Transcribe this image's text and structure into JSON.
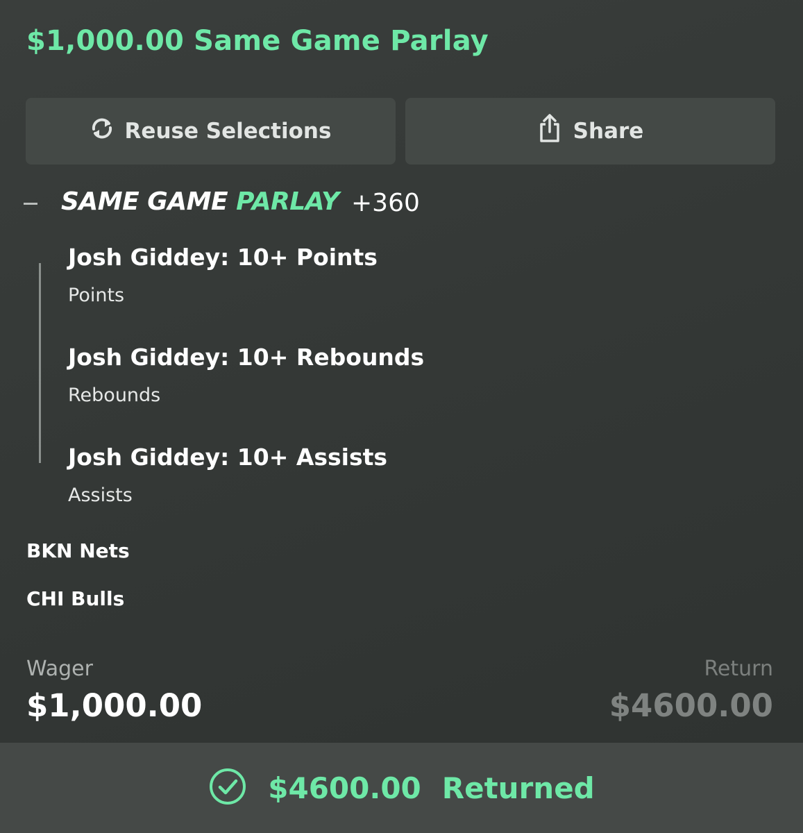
{
  "header": {
    "title": "$1,000.00 Same Game Parlay"
  },
  "actions": {
    "reuse_label": "Reuse Selections",
    "share_label": "Share"
  },
  "parlay": {
    "label_part1": "SAME GAME ",
    "label_part2": "PARLAY",
    "odds": "+360",
    "legs": [
      {
        "title": "Josh Giddey: 10+ Points",
        "market": "Points"
      },
      {
        "title": "Josh Giddey: 10+ Rebounds",
        "market": "Rebounds"
      },
      {
        "title": "Josh Giddey: 10+ Assists",
        "market": "Assists"
      }
    ]
  },
  "teams": [
    "BKN Nets",
    "CHI Bulls"
  ],
  "wager": {
    "label": "Wager",
    "value": "$1,000.00"
  },
  "return": {
    "label": "Return",
    "value": "$4600.00"
  },
  "status": {
    "amount": "$4600.00",
    "text": "Returned"
  },
  "colors": {
    "accent": "#6ee8a7",
    "background": "#363a38",
    "button": "#444946",
    "status_bar": "#454947"
  },
  "icons": {
    "reuse": "refresh-icon",
    "share": "share-icon",
    "collapse": "minus-icon",
    "status": "check-circle-icon"
  }
}
